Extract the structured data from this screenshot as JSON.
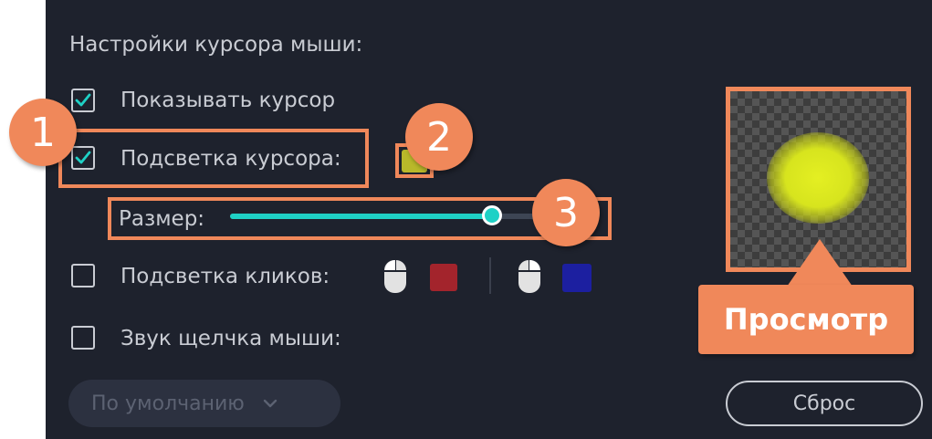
{
  "section": {
    "title": "Настройки курсора мыши:"
  },
  "options": {
    "show_cursor": {
      "label": "Показывать курсор",
      "checked": true
    },
    "cursor_highlight": {
      "label": "Подсветка курсора:",
      "checked": true,
      "color": "#b9b82a"
    },
    "size": {
      "label": "Размер:",
      "value_fraction": 0.9
    },
    "click_highlight": {
      "label": "Подсветка кликов:",
      "checked": false,
      "left_click_color": "#a3242c",
      "right_click_color": "#1c1fa0"
    },
    "click_sound": {
      "label": "Звук щелчка мыши:",
      "checked": false
    }
  },
  "dropdown": {
    "value": "По умолчанию"
  },
  "reset_button": {
    "label": "Сброс"
  },
  "annotations": {
    "badge_1": "1",
    "badge_2": "2",
    "badge_3": "3",
    "preview_label": "Просмотр",
    "accent_color": "#f0885a"
  },
  "colors": {
    "panel_bg": "#1e222d",
    "slider_track_active": "#1fd1c6",
    "slider_track_rest": "#3d4554"
  }
}
